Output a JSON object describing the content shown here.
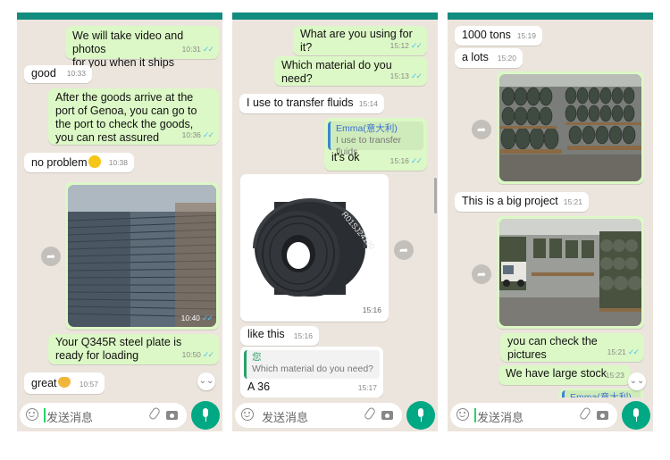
{
  "input": {
    "placeholder": "发送消息"
  },
  "panel1": {
    "messages": [
      {
        "text": "We will take video and photos\nfor you when it ships",
        "time": "10:31"
      },
      {
        "text": "good",
        "time": "10:33"
      },
      {
        "text": "After the goods arrive at the\nport of Genoa, you can go to\nthe port to check the goods,\nyou can rest assured",
        "time": "10:36"
      },
      {
        "text": "no problem",
        "time": "10:38"
      },
      {
        "time": "10:40"
      },
      {
        "text": "Your Q345R steel plate is\nready for loading",
        "time": "10:50"
      },
      {
        "text": "great",
        "time": "10:57"
      }
    ]
  },
  "panel2": {
    "messages": [
      {
        "text": "What are you using for it?",
        "time": "15:12"
      },
      {
        "text": "Which material do you need?",
        "time": "15:13"
      },
      {
        "text": "I use to transfer fluids",
        "time": "15:14"
      },
      {
        "quote_name": "Emma(意大利)",
        "quote_text": "I use to transfer fluids",
        "text": "it's ok",
        "time": "15:16"
      },
      {
        "time": "15:16",
        "coil_label": "R01SJ24120"
      },
      {
        "text": "like this",
        "time": "15:16"
      },
      {
        "quote_name": "您",
        "quote_text": "Which material do you need?",
        "text": "A 36",
        "time": "15:17"
      }
    ]
  },
  "panel3": {
    "messages": [
      {
        "text": "1000 tons",
        "time": "15:19"
      },
      {
        "text": "a lots",
        "time": "15:20"
      },
      {
        "time": ""
      },
      {
        "text": "This is a big project",
        "time": "15:21"
      },
      {
        "time": ""
      },
      {
        "text": "you can check the pictures",
        "time": "15:21"
      },
      {
        "text": "We have large stock",
        "time": "15:23"
      },
      {
        "quote_name": "Emma(意大利)"
      }
    ]
  },
  "icons": {
    "read_ticks": "double-check-icon",
    "forward": "forward-arrow-icon",
    "scroll": "chevron-double-down-icon",
    "emoji": "smiley-icon",
    "attach": "paperclip-icon",
    "camera": "camera-icon",
    "mic": "microphone-icon"
  },
  "colors": {
    "outgoing_bubble": "#dcf8c6",
    "incoming_bubble": "#ffffff",
    "chat_background": "#ece5dd",
    "header": "#128c7e",
    "accent": "#00a884",
    "read_tick": "#4fc3f7"
  }
}
